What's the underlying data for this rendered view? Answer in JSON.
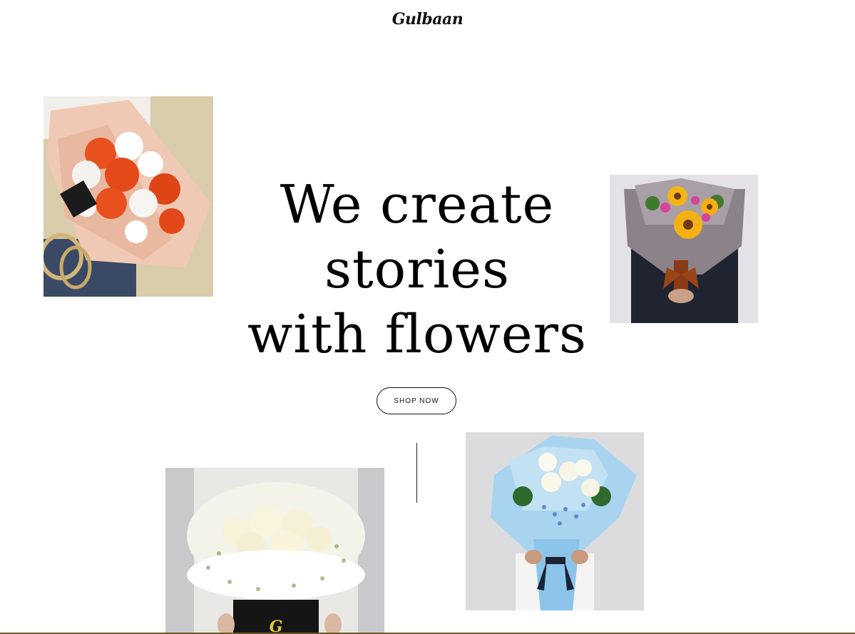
{
  "brand": {
    "logo_text": "Gulbaan"
  },
  "hero": {
    "line1": "We create",
    "line2": "stories",
    "line3": "with flowers",
    "button_label": "SHOP NOW"
  },
  "colors": {
    "background": "#ffffff",
    "text": "#000000",
    "button_border": "#111111"
  }
}
